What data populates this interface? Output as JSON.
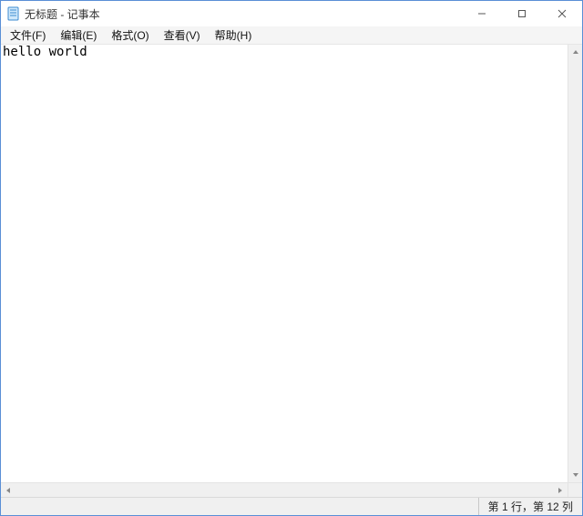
{
  "titlebar": {
    "title": "无标题 - 记事本"
  },
  "menubar": {
    "items": [
      {
        "label": "文件(F)"
      },
      {
        "label": "编辑(E)"
      },
      {
        "label": "格式(O)"
      },
      {
        "label": "查看(V)"
      },
      {
        "label": "帮助(H)"
      }
    ]
  },
  "editor": {
    "content": "hello world"
  },
  "statusbar": {
    "position": "第 1 行，第 12 列"
  }
}
